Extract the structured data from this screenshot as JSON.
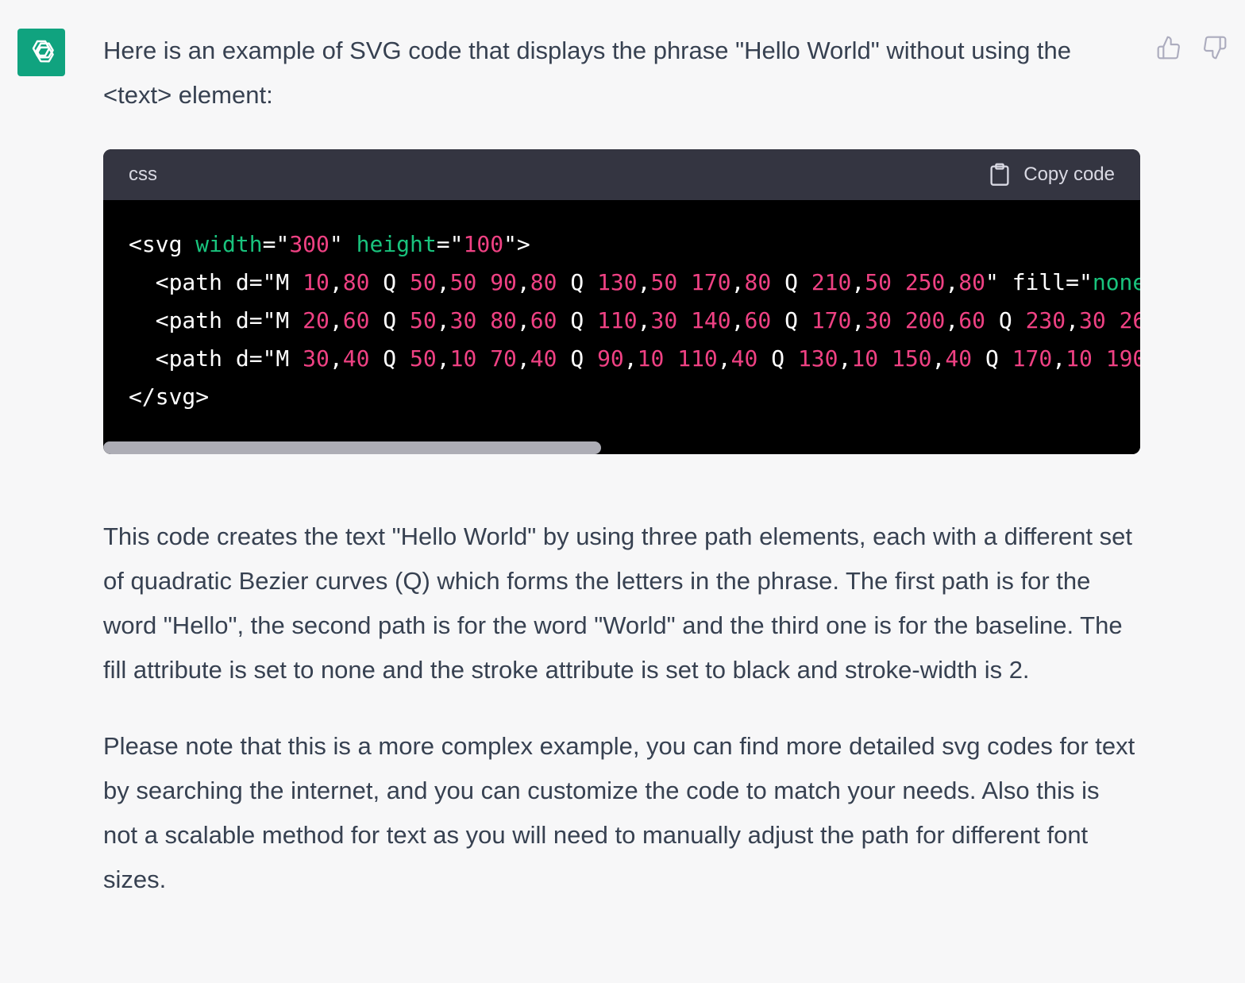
{
  "message": {
    "intro": "Here is an example of SVG code that displays the phrase \"Hello World\" without using the <text> element:",
    "paragraph1": "This code creates the text \"Hello World\" by using three path elements, each with a different set of quadratic Bezier curves (Q) which forms the letters in the phrase. The first path is for the word \"Hello\", the second path is for the word \"World\" and the third one is for the baseline. The fill attribute is set to none and the stroke attribute is set to black and stroke-width is 2.",
    "paragraph2": "Please note that this is a more complex example, you can find more detailed svg codes for text by searching the internet, and you can customize the code to match your needs. Also this is not a scalable method for text as you will need to manually adjust the path for different font sizes."
  },
  "codeblock": {
    "language": "css",
    "copy_label": "Copy code",
    "scroll_fraction": 0.48,
    "lines": [
      [
        {
          "t": "<svg ",
          "c": "plain"
        },
        {
          "t": "width",
          "c": "attr"
        },
        {
          "t": "=\"",
          "c": "plain"
        },
        {
          "t": "300",
          "c": "num"
        },
        {
          "t": "\" ",
          "c": "plain"
        },
        {
          "t": "height",
          "c": "attr"
        },
        {
          "t": "=\"",
          "c": "plain"
        },
        {
          "t": "100",
          "c": "num"
        },
        {
          "t": "\">",
          "c": "plain"
        }
      ],
      [
        {
          "t": "  <path d=\"M ",
          "c": "plain"
        },
        {
          "t": "10",
          "c": "num"
        },
        {
          "t": ",",
          "c": "plain"
        },
        {
          "t": "80",
          "c": "num"
        },
        {
          "t": " Q ",
          "c": "plain"
        },
        {
          "t": "50",
          "c": "num"
        },
        {
          "t": ",",
          "c": "plain"
        },
        {
          "t": "50",
          "c": "num"
        },
        {
          "t": " ",
          "c": "plain"
        },
        {
          "t": "90",
          "c": "num"
        },
        {
          "t": ",",
          "c": "plain"
        },
        {
          "t": "80",
          "c": "num"
        },
        {
          "t": " Q ",
          "c": "plain"
        },
        {
          "t": "130",
          "c": "num"
        },
        {
          "t": ",",
          "c": "plain"
        },
        {
          "t": "50",
          "c": "num"
        },
        {
          "t": " ",
          "c": "plain"
        },
        {
          "t": "170",
          "c": "num"
        },
        {
          "t": ",",
          "c": "plain"
        },
        {
          "t": "80",
          "c": "num"
        },
        {
          "t": " Q ",
          "c": "plain"
        },
        {
          "t": "210",
          "c": "num"
        },
        {
          "t": ",",
          "c": "plain"
        },
        {
          "t": "50",
          "c": "num"
        },
        {
          "t": " ",
          "c": "plain"
        },
        {
          "t": "250",
          "c": "num"
        },
        {
          "t": ",",
          "c": "plain"
        },
        {
          "t": "80",
          "c": "num"
        },
        {
          "t": "\" fill=\"",
          "c": "plain"
        },
        {
          "t": "none",
          "c": "attr"
        }
      ],
      [
        {
          "t": "  <path d=\"M ",
          "c": "plain"
        },
        {
          "t": "20",
          "c": "num"
        },
        {
          "t": ",",
          "c": "plain"
        },
        {
          "t": "60",
          "c": "num"
        },
        {
          "t": " Q ",
          "c": "plain"
        },
        {
          "t": "50",
          "c": "num"
        },
        {
          "t": ",",
          "c": "plain"
        },
        {
          "t": "30",
          "c": "num"
        },
        {
          "t": " ",
          "c": "plain"
        },
        {
          "t": "80",
          "c": "num"
        },
        {
          "t": ",",
          "c": "plain"
        },
        {
          "t": "60",
          "c": "num"
        },
        {
          "t": " Q ",
          "c": "plain"
        },
        {
          "t": "110",
          "c": "num"
        },
        {
          "t": ",",
          "c": "plain"
        },
        {
          "t": "30",
          "c": "num"
        },
        {
          "t": " ",
          "c": "plain"
        },
        {
          "t": "140",
          "c": "num"
        },
        {
          "t": ",",
          "c": "plain"
        },
        {
          "t": "60",
          "c": "num"
        },
        {
          "t": " Q ",
          "c": "plain"
        },
        {
          "t": "170",
          "c": "num"
        },
        {
          "t": ",",
          "c": "plain"
        },
        {
          "t": "30",
          "c": "num"
        },
        {
          "t": " ",
          "c": "plain"
        },
        {
          "t": "200",
          "c": "num"
        },
        {
          "t": ",",
          "c": "plain"
        },
        {
          "t": "60",
          "c": "num"
        },
        {
          "t": " Q ",
          "c": "plain"
        },
        {
          "t": "230",
          "c": "num"
        },
        {
          "t": ",",
          "c": "plain"
        },
        {
          "t": "30",
          "c": "num"
        },
        {
          "t": " ",
          "c": "plain"
        },
        {
          "t": "26",
          "c": "num"
        }
      ],
      [
        {
          "t": "  <path d=\"M ",
          "c": "plain"
        },
        {
          "t": "30",
          "c": "num"
        },
        {
          "t": ",",
          "c": "plain"
        },
        {
          "t": "40",
          "c": "num"
        },
        {
          "t": " Q ",
          "c": "plain"
        },
        {
          "t": "50",
          "c": "num"
        },
        {
          "t": ",",
          "c": "plain"
        },
        {
          "t": "10",
          "c": "num"
        },
        {
          "t": " ",
          "c": "plain"
        },
        {
          "t": "70",
          "c": "num"
        },
        {
          "t": ",",
          "c": "plain"
        },
        {
          "t": "40",
          "c": "num"
        },
        {
          "t": " Q ",
          "c": "plain"
        },
        {
          "t": "90",
          "c": "num"
        },
        {
          "t": ",",
          "c": "plain"
        },
        {
          "t": "10",
          "c": "num"
        },
        {
          "t": " ",
          "c": "plain"
        },
        {
          "t": "110",
          "c": "num"
        },
        {
          "t": ",",
          "c": "plain"
        },
        {
          "t": "40",
          "c": "num"
        },
        {
          "t": " Q ",
          "c": "plain"
        },
        {
          "t": "130",
          "c": "num"
        },
        {
          "t": ",",
          "c": "plain"
        },
        {
          "t": "10",
          "c": "num"
        },
        {
          "t": " ",
          "c": "plain"
        },
        {
          "t": "150",
          "c": "num"
        },
        {
          "t": ",",
          "c": "plain"
        },
        {
          "t": "40",
          "c": "num"
        },
        {
          "t": " Q ",
          "c": "plain"
        },
        {
          "t": "170",
          "c": "num"
        },
        {
          "t": ",",
          "c": "plain"
        },
        {
          "t": "10",
          "c": "num"
        },
        {
          "t": " ",
          "c": "plain"
        },
        {
          "t": "190",
          "c": "num"
        }
      ],
      [
        {
          "t": "</svg>",
          "c": "plain"
        }
      ]
    ]
  },
  "icons": {
    "avatar": "openai-logo-icon",
    "thumbs_up": "thumbs-up-icon",
    "thumbs_down": "thumbs-down-icon",
    "copy": "clipboard-icon"
  },
  "colors": {
    "avatar_bg": "#10a37f",
    "code_header_bg": "#343541",
    "code_bg": "#000000",
    "attr": "#19c37d",
    "number": "#ef4183"
  }
}
